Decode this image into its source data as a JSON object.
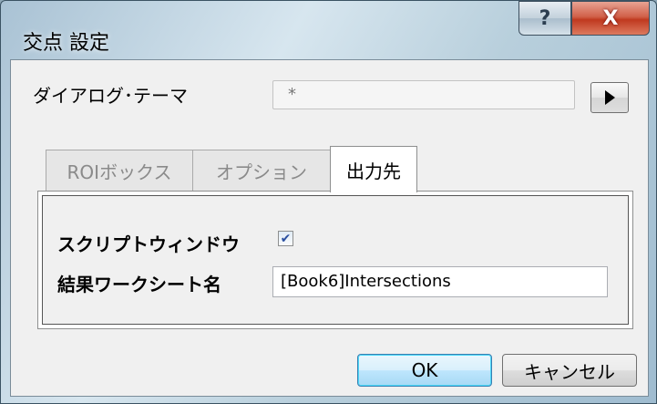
{
  "window": {
    "title": "交点 設定",
    "help_label": "?",
    "close_label": "X"
  },
  "theme": {
    "label": "ダイアログ･テーマ",
    "value": "*"
  },
  "tabs": [
    {
      "label": "ROIボックス",
      "active": false
    },
    {
      "label": "オプション",
      "active": false
    },
    {
      "label": "出力先",
      "active": true
    }
  ],
  "output": {
    "script_window_label": "スクリプトウィンドウ",
    "script_window_checked": true,
    "sheet_name_label": "結果ワークシート名",
    "sheet_name_value": "[Book6]Intersections"
  },
  "buttons": {
    "ok": "OK",
    "cancel": "キャンセル"
  }
}
